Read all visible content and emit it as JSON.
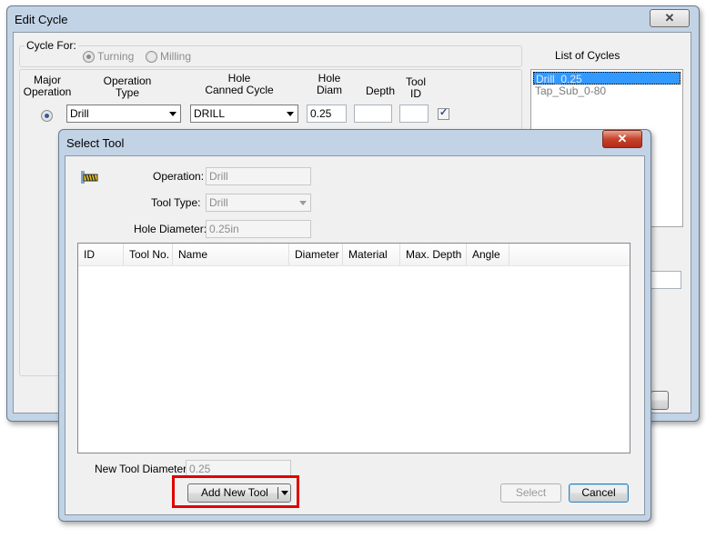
{
  "edit_cycle": {
    "title": "Edit Cycle",
    "close_glyph": "✕",
    "cycle_for_label": "Cycle For:",
    "turning_label": "Turning",
    "milling_label": "Milling",
    "headers": {
      "major_operation": "Major\nOperation",
      "operation_type": "Operation\nType",
      "hole_canned_cycle": "Hole\nCanned Cycle",
      "hole_diam": "Hole\nDiam",
      "depth": "Depth",
      "tool_id": "Tool\nID"
    },
    "operation_type_value": "Drill",
    "canned_cycle_value": "DRILL",
    "hole_diam_value": "0.25",
    "depth_value": "",
    "tool_id_value": "",
    "list_of_cycles_label": "List of Cycles",
    "cycles": [
      "Drill_0.25",
      "Tap_Sub_0-80"
    ]
  },
  "select_tool": {
    "title": "Select Tool",
    "close_glyph": "✕",
    "operation_label": "Operation:",
    "operation_value": "Drill",
    "tool_type_label": "Tool Type:",
    "tool_type_value": "Drill",
    "hole_diameter_label": "Hole Diameter:",
    "hole_diameter_value": "0.25in",
    "columns": [
      "ID",
      "Tool No.",
      "Name",
      "Diameter",
      "Material",
      "Max. Depth",
      "Angle"
    ],
    "rows": [],
    "new_tool_diameter_label": "New Tool Diameter:",
    "new_tool_diameter_value": "0.25",
    "add_new_tool_label": "Add New Tool",
    "select_label": "Select",
    "cancel_label": "Cancel"
  },
  "colors": {
    "highlight_box": "#e00000",
    "selection": "#3399ff",
    "window_frame": "#c3d3e6"
  },
  "icons": {
    "drill_tool": "drill-tool-icon",
    "dropdown": "chevron-down-icon",
    "close": "close-icon"
  }
}
